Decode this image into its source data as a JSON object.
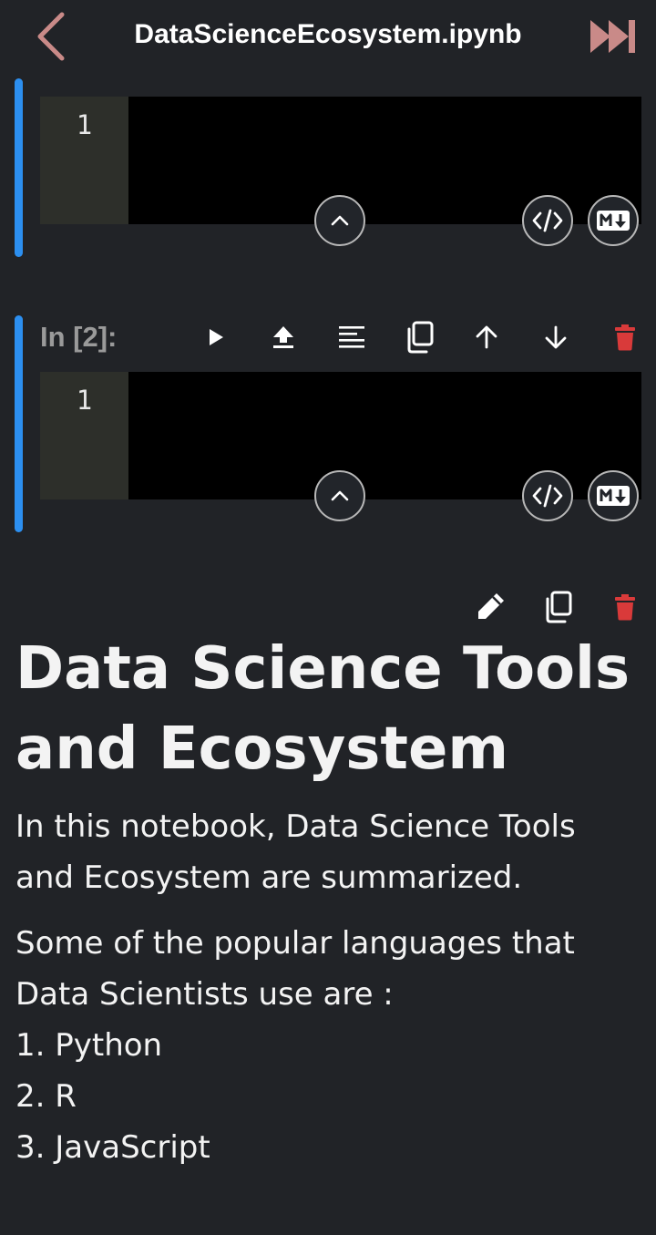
{
  "header": {
    "title": "DataScienceEcosystem.ipynb",
    "back_icon": "chevron-left-icon",
    "run_all_icon": "fast-forward-icon",
    "accent_color": "#c98a88"
  },
  "cell1": {
    "line_number": "1",
    "collapse_icon": "chevron-up-icon",
    "code_icon": "code-icon",
    "markdown_icon": "markdown-icon"
  },
  "cell2": {
    "prompt": "In [2]:",
    "line_number": "1",
    "toolbar": [
      "play-icon",
      "upload-icon",
      "format-icon",
      "copy-icon",
      "arrow-up-icon",
      "arrow-down-icon",
      "trash-icon"
    ],
    "collapse_icon": "chevron-up-icon",
    "code_icon": "code-icon",
    "markdown_icon": "markdown-icon"
  },
  "markdown_cell": {
    "toolbar": [
      "pencil-icon",
      "copy-icon",
      "trash-icon"
    ],
    "heading": "Data Science Tools and Ecosystem",
    "intro": "In this notebook, Data Science Tools and Ecosystem are summarized.",
    "languages_intro": "Some of the popular languages that Data Scientists use are :",
    "languages": [
      "1. Python",
      "2. R",
      "3. JavaScript"
    ]
  },
  "colors": {
    "background": "#212327",
    "cell_bar": "#2c8ff0",
    "delete": "#d93a3a",
    "editor": "#000000",
    "gutter": "#2d2f2a"
  }
}
